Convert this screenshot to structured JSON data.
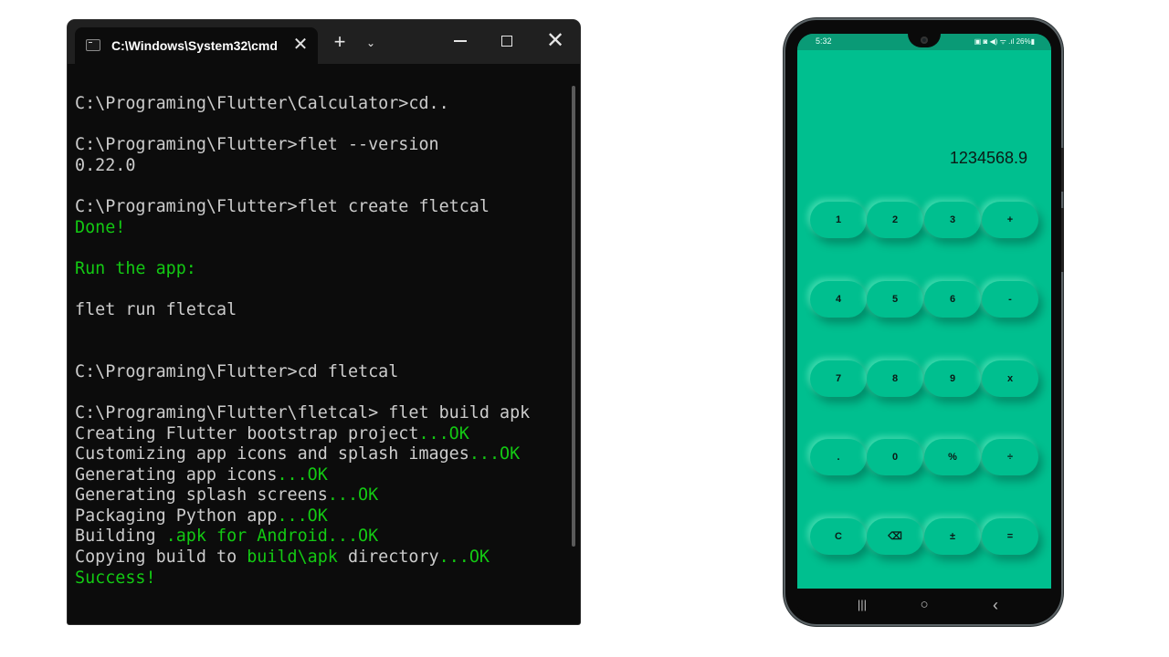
{
  "terminal": {
    "tab_title": "C:\\Windows\\System32\\cmd",
    "tab_close_glyph": "✕",
    "new_tab_glyph": "+",
    "dropdown_glyph": "⌄",
    "close_glyph": "✕",
    "colors": {
      "background": "#0c0c0c",
      "text": "#cccccc",
      "success": "#13c913",
      "titlebar": "#202020"
    },
    "lines": [
      [
        {
          "t": "C:\\Programing\\Flutter\\Calculator>cd.."
        }
      ],
      [
        {
          "t": ""
        }
      ],
      [
        {
          "t": "C:\\Programing\\Flutter>flet --version"
        }
      ],
      [
        {
          "t": "0.22.0"
        }
      ],
      [
        {
          "t": ""
        }
      ],
      [
        {
          "t": "C:\\Programing\\Flutter>flet create fletcal"
        }
      ],
      [
        {
          "t": "Done!",
          "g": true
        }
      ],
      [
        {
          "t": ""
        }
      ],
      [
        {
          "t": "Run the app:",
          "g": true
        }
      ],
      [
        {
          "t": ""
        }
      ],
      [
        {
          "t": "flet run fletcal"
        }
      ],
      [
        {
          "t": ""
        }
      ],
      [
        {
          "t": ""
        }
      ],
      [
        {
          "t": "C:\\Programing\\Flutter>cd fletcal"
        }
      ],
      [
        {
          "t": ""
        }
      ],
      [
        {
          "t": "C:\\Programing\\Flutter\\fletcal> flet build apk"
        }
      ],
      [
        {
          "t": "Creating Flutter bootstrap project"
        },
        {
          "t": "...OK",
          "g": true
        }
      ],
      [
        {
          "t": "Customizing app icons and splash images"
        },
        {
          "t": "...OK",
          "g": true
        }
      ],
      [
        {
          "t": "Generating app icons"
        },
        {
          "t": "...OK",
          "g": true
        }
      ],
      [
        {
          "t": "Generating splash screens"
        },
        {
          "t": "...OK",
          "g": true
        }
      ],
      [
        {
          "t": "Packaging Python app"
        },
        {
          "t": "...OK",
          "g": true
        }
      ],
      [
        {
          "t": "Building "
        },
        {
          "t": ".apk for Android...OK",
          "g": true
        }
      ],
      [
        {
          "t": "Copying build to "
        },
        {
          "t": "build\\apk",
          "g": true
        },
        {
          "t": " directory"
        },
        {
          "t": "...OK",
          "g": true
        }
      ],
      [
        {
          "t": "Success!",
          "g": true
        }
      ]
    ]
  },
  "phone": {
    "status_time": "5:32",
    "status_icons": "▣ ◙ ◀) ᯤ .ıl 26%▮",
    "display_value": "1234568.9",
    "colors": {
      "screen": "#00bf8f",
      "text": "#0b1a16"
    },
    "keys": [
      [
        "1",
        "2",
        "3",
        "+"
      ],
      [
        "4",
        "5",
        "6",
        "-"
      ],
      [
        "7",
        "8",
        "9",
        "x"
      ],
      [
        ".",
        "0",
        "%",
        "÷"
      ],
      [
        "C",
        "⌫",
        "±",
        "="
      ]
    ],
    "nav": {
      "recents": "|||",
      "home": "○",
      "back": "‹"
    }
  }
}
